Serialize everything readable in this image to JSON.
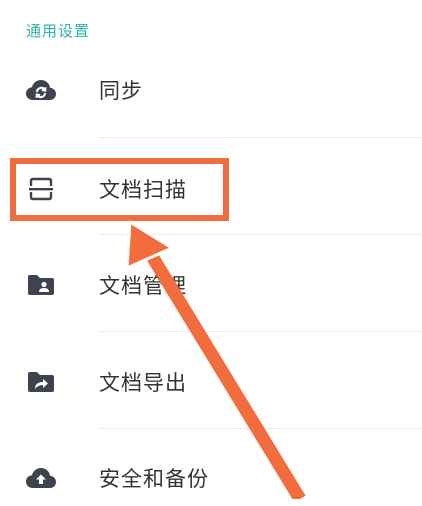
{
  "section": {
    "title": "通用设置"
  },
  "items": [
    {
      "label": "同步",
      "icon": "cloud-sync-icon"
    },
    {
      "label": "文档扫描",
      "icon": "scan-icon"
    },
    {
      "label": "文档管理",
      "icon": "folder-user-icon"
    },
    {
      "label": "文档导出",
      "icon": "folder-export-icon"
    },
    {
      "label": "安全和备份",
      "icon": "cloud-upload-icon"
    }
  ],
  "colors": {
    "accent": "#2bb3a3",
    "icon": "#3d4450",
    "text": "#333333",
    "annotation": "#f26d3d"
  }
}
